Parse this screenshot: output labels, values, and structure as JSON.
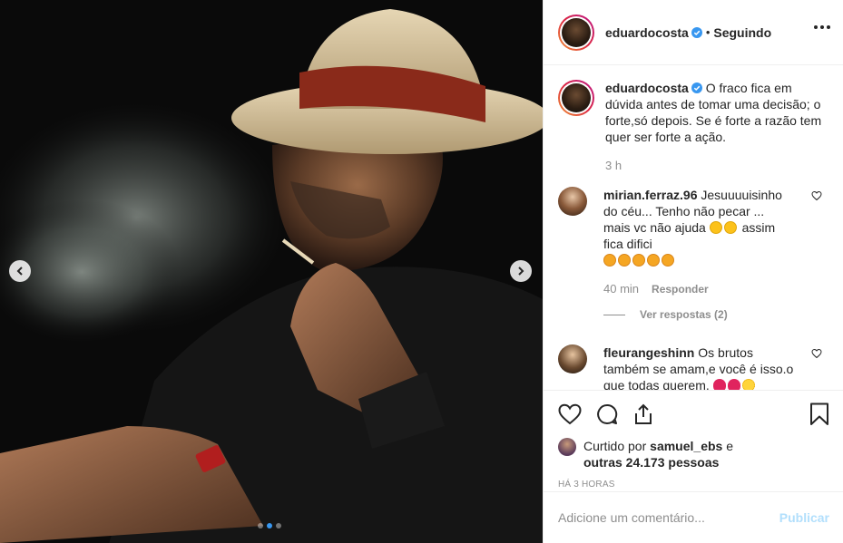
{
  "post": {
    "image_alt": "Homem de chapéu de palha fumando",
    "carousel": {
      "total": 3,
      "active": 1
    }
  },
  "header": {
    "username": "eduardocosta",
    "bullet": "•",
    "follow_state": "Seguindo",
    "more_icon": "more-horizontal-icon"
  },
  "caption": {
    "username": "eduardocosta",
    "text": "O fraco fica em dúvida antes de tomar uma decisão; o forte,só depois. Se é forte a razão tem quer ser forte a ação.",
    "time": "3 h"
  },
  "comments": [
    {
      "username": "mirian.ferraz.96",
      "text_part1": "Jesuuuuisinho do céu... Tenho não pecar ... mais vc não ajuda",
      "text_part2": "assim fica difici",
      "time": "40 min",
      "reply_label": "Responder",
      "view_replies": "Ver respostas (2)"
    },
    {
      "username": "fleurangeshinn",
      "text": "Os brutos também se amam,e você é isso.o que todas querem."
    }
  ],
  "likes": {
    "prefix": "Curtido por",
    "username": "samuel_ebs",
    "conjunction": "e",
    "others": "outras 24.173 pessoas"
  },
  "posted": "HÁ 3 HORAS",
  "add_comment": {
    "placeholder": "Adicione um comentário...",
    "publish_label": "Publicar"
  },
  "colors": {
    "verified": "#3897f0",
    "carousel_active": "#3897f0",
    "publish_disabled": "#b2dffc",
    "meta_gray": "#8e8e8e"
  }
}
